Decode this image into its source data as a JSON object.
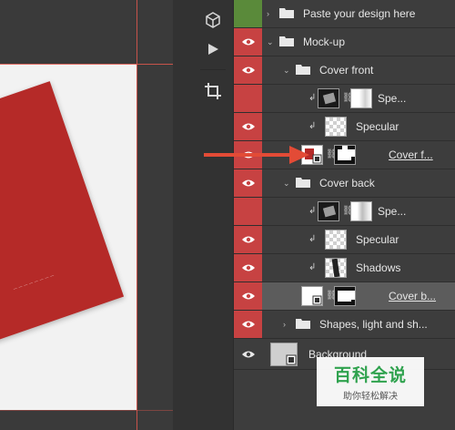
{
  "layers": [
    {
      "id": "paste",
      "label": "Paste your design here",
      "visibility": "hidden",
      "vis_color": "#5a8a3a",
      "kind": "folder",
      "expanded": false
    },
    {
      "id": "mockup",
      "label": "Mock-up",
      "visibility": "visible",
      "vis_color": "#c74242",
      "kind": "folder",
      "expanded": true
    },
    {
      "id": "cover_front",
      "label": "Cover front",
      "visibility": "visible",
      "vis_color": "#c74242",
      "kind": "folder",
      "expanded": true
    },
    {
      "id": "spe1",
      "label": "Spe...",
      "visibility": "hidden",
      "vis_color": "#c74242",
      "kind": "masked"
    },
    {
      "id": "specular1",
      "label": "Specular",
      "visibility": "visible",
      "vis_color": "#c74242",
      "kind": "clipped"
    },
    {
      "id": "cover_f",
      "label": "Cover f...",
      "visibility": "visible",
      "vis_color": "#c74242",
      "kind": "smart",
      "link": true
    },
    {
      "id": "cover_back",
      "label": "Cover back",
      "visibility": "visible",
      "vis_color": "#c74242",
      "kind": "folder",
      "expanded": true
    },
    {
      "id": "spe2",
      "label": "Spe...",
      "visibility": "hidden",
      "vis_color": "#c74242",
      "kind": "masked"
    },
    {
      "id": "specular2",
      "label": "Specular",
      "visibility": "visible",
      "vis_color": "#c74242",
      "kind": "clipped"
    },
    {
      "id": "shadows",
      "label": "Shadows",
      "visibility": "visible",
      "vis_color": "#c74242",
      "kind": "clipped"
    },
    {
      "id": "cover_b",
      "label": "Cover b...",
      "visibility": "visible",
      "vis_color": "#c74242",
      "kind": "smart",
      "link": true,
      "selected": true
    },
    {
      "id": "shapes",
      "label": "Shapes, light and sh...",
      "visibility": "visible",
      "vis_color": "#c74242",
      "kind": "folder",
      "expanded": false
    },
    {
      "id": "background",
      "label": "Background",
      "visibility": "visible",
      "vis_color": "transparent",
      "kind": "smartbg"
    }
  ],
  "tools": [
    {
      "name": "3d-object-icon"
    },
    {
      "name": "play-icon"
    },
    {
      "name": "crop-icon"
    }
  ],
  "colors": {
    "panel_bg": "#3d3d3d",
    "visibility_red": "#c74242",
    "visibility_green": "#5a8a3a",
    "selected_row": "#5c5c5c",
    "arrow": "#e34b36",
    "cover_red": "#b52a28"
  },
  "watermark": {
    "logo": "百科全说",
    "tagline": "助你轻松解决"
  }
}
